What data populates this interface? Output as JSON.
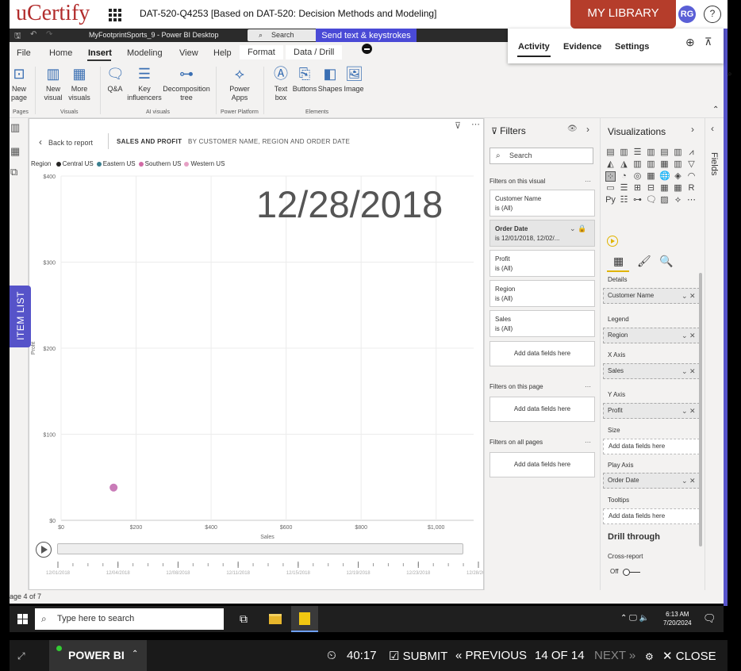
{
  "ucertify": {
    "logo": "uCertify",
    "course_title": "DAT-520-Q4253  [Based on DAT-520: Decision Methods and Modeling]",
    "my_library": "MY LIBRARY",
    "user_initials": "RG",
    "help": "?"
  },
  "pbi": {
    "app_name": "MyFootprintSports_9 - Power BI Desktop",
    "search_label": "Search",
    "send_text": "Send text & keystrokes"
  },
  "menu": {
    "file": "File",
    "home": "Home",
    "insert": "Insert",
    "modeling": "Modeling",
    "view": "View",
    "help": "Help",
    "format": "Format",
    "data_drill": "Data / Drill"
  },
  "ribbon": {
    "new_page": "New\npage",
    "new_visual": "New\nvisual",
    "more_visuals": "More\nvisuals",
    "qa": "Q&A",
    "key_influencers": "Key\ninfluencers",
    "decomposition_tree": "Decomposition\ntree",
    "power_apps": "Power\nApps",
    "text_box": "Text\nbox",
    "buttons": "Buttons",
    "shapes": "Shapes",
    "image": "Image",
    "groups": {
      "pages": "Pages",
      "visuals": "Visuals",
      "ai_visuals": "AI visuals",
      "power_platform": "Power Platform",
      "elements": "Elements"
    }
  },
  "activity_panel": {
    "activity": "Activity",
    "evidence": "Evidence",
    "settings": "Settings"
  },
  "item_list": "ITEM LIST",
  "canvas": {
    "back": "Back to report",
    "title": "SALES AND PROFIT",
    "subtitle": "BY CUSTOMER NAME, REGION AND ORDER DATE",
    "legend_label": "Region",
    "play_date": "12/28/2018"
  },
  "chart_data": {
    "type": "scatter",
    "xlabel": "Sales",
    "ylabel": "Profit",
    "x_ticks": [
      "$0",
      "$200",
      "$400",
      "$600",
      "$800",
      "$1,000"
    ],
    "y_ticks": [
      "$0",
      "$100",
      "$200",
      "$300",
      "$400"
    ],
    "xlim": [
      0,
      1100
    ],
    "ylim": [
      0,
      400
    ],
    "series": [
      {
        "name": "Central US",
        "color": "#252423"
      },
      {
        "name": "Eastern US",
        "color": "#3a7f8f"
      },
      {
        "name": "Southern US",
        "color": "#d16ba5"
      },
      {
        "name": "Western US",
        "color": "#e6a0c4"
      }
    ],
    "points": [
      {
        "x": 140,
        "y": 38,
        "series": "Southern US",
        "color": "#c97bb8"
      }
    ],
    "timeline_ticks": [
      "12/01/2018",
      "12/04/2018",
      "12/08/2018",
      "12/11/2018",
      "12/15/2018",
      "12/19/2018",
      "12/23/2018",
      "12/28/2018"
    ]
  },
  "page_status": "age 4 of 7",
  "filters": {
    "title": "Filters",
    "search": "Search",
    "on_visual": "Filters on this visual",
    "on_page": "Filters on this page",
    "on_all": "Filters on all pages",
    "add_fields": "Add data fields here",
    "cards": [
      {
        "title": "Customer Name",
        "value": "is (All)"
      },
      {
        "title": "Order Date",
        "value": "is 12/01/2018, 12/02/..."
      },
      {
        "title": "Profit",
        "value": "is (All)"
      },
      {
        "title": "Region",
        "value": "is (All)"
      },
      {
        "title": "Sales",
        "value": "is (All)"
      }
    ]
  },
  "visualizations": {
    "title": "Visualizations",
    "details": "Details",
    "customer_name": "Customer Name",
    "legend": "Legend",
    "region": "Region",
    "x_axis": "X Axis",
    "sales": "Sales",
    "y_axis": "Y Axis",
    "profit": "Profit",
    "size": "Size",
    "add_fields": "Add data fields here",
    "play_axis": "Play Axis",
    "order_date": "Order Date",
    "tooltips": "Tooltips",
    "drill_through": "Drill through",
    "cross_report": "Cross-report",
    "off": "Off"
  },
  "fields_label": "Fields",
  "taskbar": {
    "search": "Type here to search",
    "time": "6:13 AM",
    "date": "7/20/2024"
  },
  "bottom_bar": {
    "tab": "POWER BI",
    "timer": "40:17",
    "submit": "SUBMIT",
    "previous": "PREVIOUS",
    "progress": "14 OF 14",
    "next": "NEXT",
    "close": "CLOSE"
  }
}
